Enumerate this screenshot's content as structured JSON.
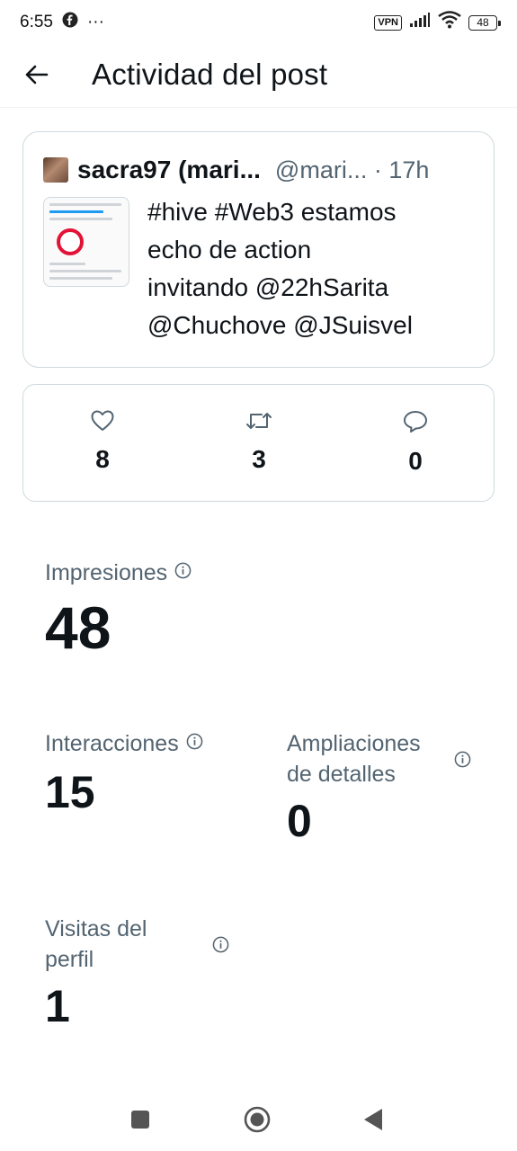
{
  "status_bar": {
    "time": "6:55",
    "dots": "···",
    "vpn": "VPN",
    "battery": "48"
  },
  "header": {
    "title": "Actividad del post"
  },
  "post": {
    "author_name": "sacra97 (mari...",
    "author_handle": "@mari... · 17h",
    "text_lines": [
      "#hive #Web3  estamos",
      "echo de action",
      "invitando @22hSarita",
      "@Chuchove @JSuisvel"
    ]
  },
  "engagement": {
    "likes": "8",
    "reposts": "3",
    "replies": "0"
  },
  "metrics": {
    "impressions_label": "Impresiones",
    "impressions_value": "48",
    "interactions_label": "Interacciones",
    "interactions_value": "15",
    "expansions_label_1": "Ampliaciones",
    "expansions_label_2": "de detalles",
    "expansions_value": "0",
    "profile_visits_label_1": "Visitas del",
    "profile_visits_label_2": "perfil",
    "profile_visits_value": "1"
  },
  "colors": {
    "text_primary": "#0f1419",
    "text_secondary": "#536471",
    "border": "#cfd9de",
    "hive_red": "#e31337"
  }
}
